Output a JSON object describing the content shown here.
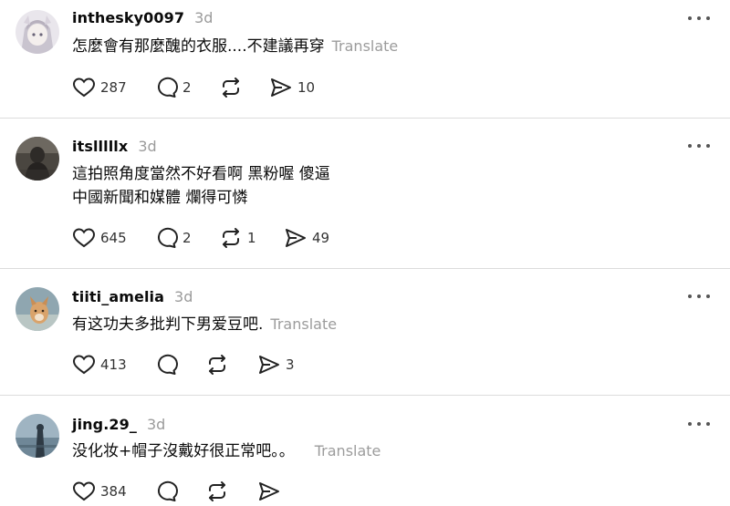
{
  "actions_ui": {
    "translate_label": "Translate"
  },
  "posts": [
    {
      "username": "inthesky0097",
      "time": "3d",
      "lines": [
        "怎麼會有那麼醜的衣服....不建議再穿"
      ],
      "translate": true,
      "likes": "287",
      "replies": "2",
      "reposts": "",
      "shares": "10"
    },
    {
      "username": "itslllllx",
      "time": "3d",
      "lines": [
        "這拍照角度當然不好看啊 黑粉喔 傻逼",
        "中國新聞和媒體 爛得可憐"
      ],
      "translate": false,
      "likes": "645",
      "replies": "2",
      "reposts": "1",
      "shares": "49"
    },
    {
      "username": "tiiti_amelia",
      "time": "3d",
      "lines": [
        "有这功夫多批判下男爱豆吧."
      ],
      "translate": true,
      "likes": "413",
      "replies": "",
      "reposts": "",
      "shares": "3"
    },
    {
      "username": "jing.29_",
      "time": "3d",
      "lines": [
        "没化妆+帽子沒戴好很正常吧。。"
      ],
      "translate": true,
      "likes": "384",
      "replies": "",
      "reposts": "",
      "shares": ""
    }
  ]
}
